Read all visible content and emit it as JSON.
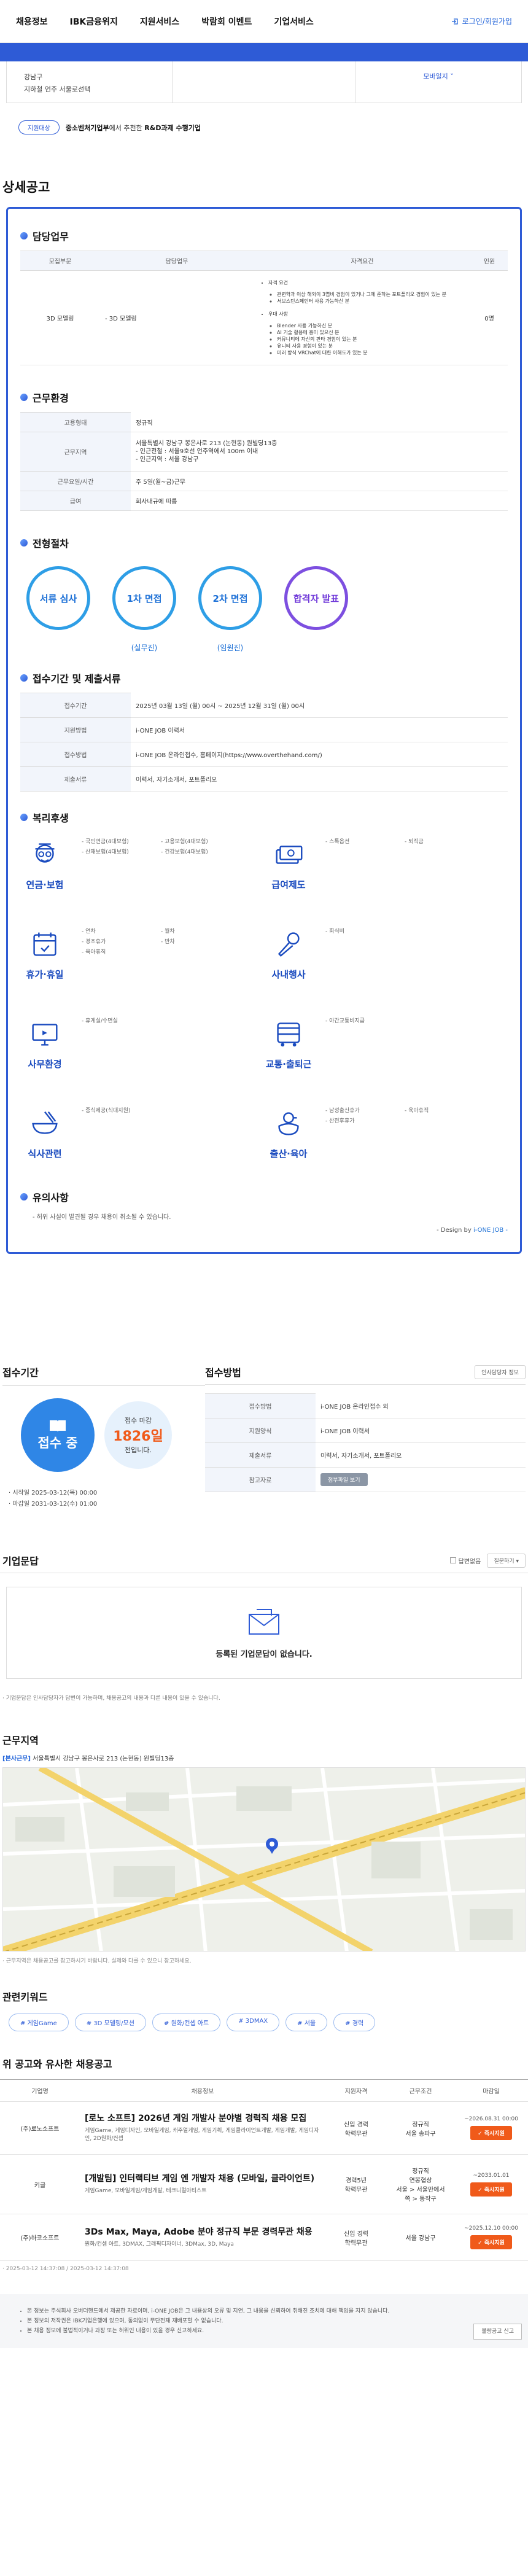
{
  "nav": {
    "items": [
      "채용정보",
      "IBK금융위지",
      "지원서비스",
      "박람회 이벤트",
      "기업서비스"
    ],
    "login": "로그인/회원가입"
  },
  "location": {
    "line1": "강남구",
    "line2": "지하철 언주 서울로선택",
    "right": "모바일지 ˅"
  },
  "support": {
    "pill": "지원대상",
    "text_bold": "중소벤처기업부",
    "text_mid": "에서 추천한 ",
    "text_bold2": "R&D과제 수행기업"
  },
  "detail_title": "상세공고",
  "duty": {
    "title": "담당업무",
    "headers": [
      "모집부문",
      "담당업무",
      "자격요건",
      "인원"
    ],
    "row": {
      "dept": "3D 모델링",
      "task": "- 3D 모델링",
      "qual_head1": "자격 요건",
      "qual1": [
        "관련학과 이상 해외이 3엽비 경험이 있거나 그에 준하는 포트폴리오 경험이 있는 분",
        "서브스턴스페인터 사용 가능하신 분"
      ],
      "qual_head2": "우대 사항",
      "qual2": [
        "Blender 사용 가능하신 분",
        "AI 기술 활용에 흥미 있으신 분",
        "커뮤니티에 자신의 판타 경험이 있는 분",
        "유니티 사용 경험이 있는 분",
        "미러 방식 VRChat에 대한 이해도가 있는 분"
      ],
      "count": "0명"
    }
  },
  "env": {
    "title": "근무환경",
    "rows": [
      {
        "k": "고용형태",
        "v": "정규직"
      },
      {
        "k": "근무지역",
        "v": "서울특별시 강남구 봉은사로 213 (논현동) 원빌딩13층\n- 인근전철 : 서울9호선 언주역에서 100m 이내\n- 인근지역 : 서울 강남구"
      },
      {
        "k": "근무요일/시간",
        "v": "주 5일(월~금)근무"
      },
      {
        "k": "급여",
        "v": "회사내규에 따름"
      }
    ]
  },
  "process": {
    "title": "전형절차",
    "steps": [
      {
        "label": "서류 심사",
        "sub": ""
      },
      {
        "label": "1차 면접",
        "sub": "(실무진)"
      },
      {
        "label": "2차 면접",
        "sub": "(임원진)"
      },
      {
        "label": "합격자 발표",
        "sub": ""
      }
    ]
  },
  "period": {
    "title": "접수기간 및 제출서류",
    "rows": [
      {
        "k": "접수기간",
        "v": "2025년 03월 13일 (월) 00시 ~ 2025년 12월 31일 (월) 00시"
      },
      {
        "k": "지원방법",
        "v": "i-ONE JOB 이력서"
      },
      {
        "k": "접수방법",
        "v": "i-ONE JOB 온라인접수, 홈페이지(https://www.overthehand.com/)"
      },
      {
        "k": "제출서류",
        "v": "이력서, 자기소개서, 포트폴리오"
      }
    ]
  },
  "welfare": {
    "title": "복리후생",
    "items": [
      {
        "label": "연금·보험",
        "icon": "pension-icon",
        "list": [
          "국민연금(4대보험)",
          "산재보험(4대보험)",
          "고용보험(4대보험)",
          "건강보험(4대보험)"
        ]
      },
      {
        "label": "급여제도",
        "icon": "salary-icon",
        "list": [
          "스톡옵션",
          "퇴직금"
        ]
      },
      {
        "label": "휴가·휴일",
        "icon": "calendar-icon",
        "list": [
          "연차",
          "경조휴가",
          "육아휴직",
          "월차",
          "반차"
        ]
      },
      {
        "label": "사내행사",
        "icon": "microphone-icon",
        "list": [
          "회식비"
        ]
      },
      {
        "label": "사무환경",
        "icon": "monitor-icon",
        "list": [
          "휴게실/수면실"
        ]
      },
      {
        "label": "교통·출퇴근",
        "icon": "bus-icon",
        "list": [
          "야간교통비지급"
        ]
      },
      {
        "label": "식사관련",
        "icon": "food-icon",
        "list": [
          "중식제공(식대지원)"
        ]
      },
      {
        "label": "출산·육아",
        "icon": "duck-icon",
        "list": [
          "남성출산휴가",
          "산전후휴가",
          "육아휴직"
        ]
      }
    ]
  },
  "caution": {
    "title": "유의사항",
    "text": "- 허위 사실이 발견될 경우 채용이 취소될 수 있습니다.",
    "design_prefix": "- Design by",
    "design_brand": "i-ONE JOB -"
  },
  "apply": {
    "title": "접수기간",
    "status": "접수 중",
    "remain_label": "접수 마감",
    "remain_days": "1826일",
    "remain_suffix": "전입니다.",
    "start": "· 시작일 2025-03-12(목) 00:00",
    "end": "· 마감일 2031-03-12(수) 01:00",
    "method_title": "접수방법",
    "method_btn": "인사담당자 정보",
    "rows": [
      {
        "k": "접수방법",
        "v": "i-ONE JOB 온라인접수 외"
      },
      {
        "k": "지원양식",
        "v": "i-ONE JOB 이력서"
      },
      {
        "k": "제출서류",
        "v": "이력서, 자기소개서, 포트폴리오"
      },
      {
        "k": "참고자료",
        "v": "첨부파일 보기"
      }
    ]
  },
  "qna": {
    "title": "기업문답",
    "check": "답변없음",
    "select": "질문하기",
    "empty": "등록된 기업문답이 없습니다.",
    "note": "· 기업문답은 인사담당자가 답변이 가능하며, 채용공고의 내용과 다른 내용이 있을 수 있습니다."
  },
  "area": {
    "title": "근무지역",
    "addr_label": "[본사근무]",
    "addr": "서울특별시 강남구 봉은사로 213 (논현동) 원빌딩13층",
    "note": "· 근무지역은 채용공고를 참고하시기 바랍니다. 실제와 다를 수 있으니 참고하세요."
  },
  "keywords": {
    "title": "관련키워드",
    "items": [
      "# 게임Game",
      "# 3D 모델링/모션",
      "# 원화/컨셉 아트",
      "# 3DMAX",
      "# 서울",
      "# 경력"
    ]
  },
  "similar": {
    "title": "위 공고와 유사한 채용공고",
    "headers": [
      "기업명",
      "채용정보",
      "지원자격",
      "근무조건",
      "마감일"
    ],
    "rows": [
      {
        "company": "(주)로노소프트",
        "title": "[로노 소프트] 2026년 게임 개발사 분야별 경력직 채용 모집",
        "sub": "게임Game, 게임디자인, 모바일게임, 캐주얼게임, 게임기획, 게임클라이언트개발, 게임개발, 게임디자인, 2D원화/컨셉",
        "qual": "신입 경력\n학력무관",
        "cond": "정규직\n서울 송파구",
        "deadline": "~2026.08.31 00:00",
        "btn": "즉시지원"
      },
      {
        "company": "키글",
        "title": "[개발팀] 인터랙티브 게임 엔 개발자 채용 (모바일, 클라이언트)",
        "sub": "게임Game, 모바일게임/게임개발, 테크니컬아티스트",
        "qual": "경력5년\n학력무관",
        "cond": "정규직\n연봉협상\n서울 > 서울만에서\n쪽 > 동작구",
        "deadline": "~2033.01.01",
        "btn": "즉시지원"
      },
      {
        "company": "(주)하코소프트",
        "title": "3Ds Max, Maya, Adobe 분야 정규직 부문 경력무관 채용",
        "sub": "원화/컨셉 아트, 3DMAX, 그래픽디자이너, 3DMax, 3D, Maya",
        "qual": "신입 경력\n학력무관",
        "cond": "서울 강남구",
        "deadline": "~2025.12.10 00:00",
        "btn": "즉시지원"
      }
    ],
    "timestamp": "· 2025-03-12 14:37:08 / 2025-03-12 14:37:08"
  },
  "footer": {
    "notes": [
      "본 정보는 주식회사 오버더핸드에서 제공한 자료이며, i-ONE JOB은 그 내용상의 오류 및 지연, 그 내용을 신뢰하여 취해진 조치에 대해 책임을 지지 않습니다.",
      "본 정보의 저작권은 IBK기업은행에 있으며, 동의없이 무단전재 재배포할 수 없습니다.",
      "본 채용 정보에 불법적이거나 과장 또는 허위인 내용이 있을 경우 신고하세요."
    ],
    "report": "불량공고 신고"
  }
}
